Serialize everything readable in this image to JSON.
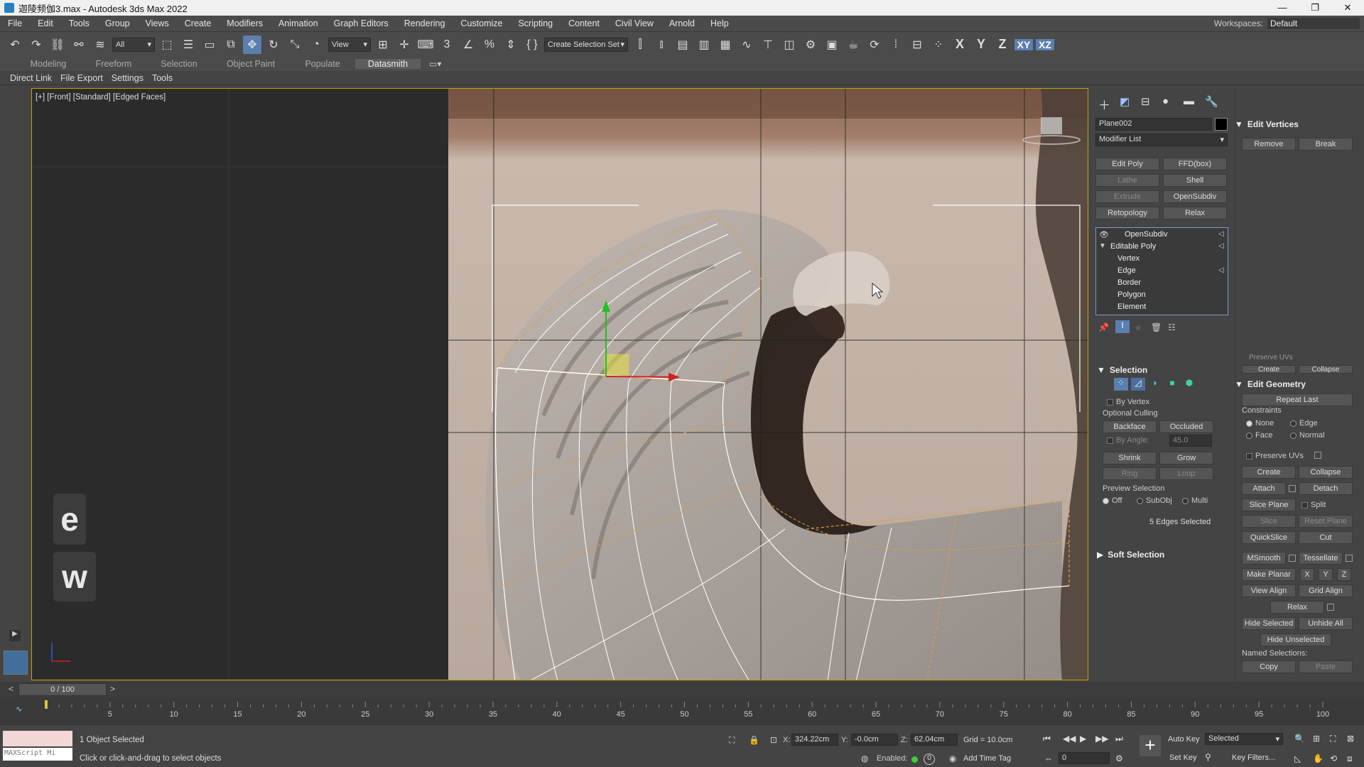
{
  "window": {
    "title": "迦陵频伽3.max - Autodesk 3ds Max 2022",
    "controls": [
      "—",
      "❐",
      "✕"
    ]
  },
  "menu": [
    "File",
    "Edit",
    "Tools",
    "Group",
    "Views",
    "Create",
    "Modifiers",
    "Animation",
    "Graph Editors",
    "Rendering",
    "Customize",
    "Scripting",
    "Content",
    "Civil View",
    "Arnold",
    "Help"
  ],
  "workspace": {
    "label": "Workspaces:",
    "value": "Default"
  },
  "toolbar": {
    "filter_value": "All",
    "refcoord_value": "View",
    "named_selection_value": "Create Selection Set",
    "axes": [
      "X",
      "Y",
      "Z",
      "XY",
      "XZ"
    ],
    "icons": [
      "undo-icon",
      "redo-icon",
      "link-icon",
      "unlink-icon",
      "bind-spacewarp-icon"
    ]
  },
  "ribbon_tabs": [
    "Modeling",
    "Freeform",
    "Selection",
    "Object Paint",
    "Populate",
    "Datasmith"
  ],
  "ribbon_active": "Datasmith",
  "subtoolbar": [
    "Direct Link",
    "File Export",
    "Settings",
    "Tools"
  ],
  "viewport": {
    "label": "[+] [Front] [Standard] [Edged Faces]",
    "key_overlays": [
      "e",
      "w"
    ],
    "colors": {
      "selection_border": "#c8a200",
      "wire": "#ffffff",
      "wire_orange": "#e0a040"
    }
  },
  "command_panel": {
    "object_name": "Plane002",
    "modifier_list": "Modifier List",
    "modifier_buttons": [
      {
        "label": "Edit Poly",
        "enabled": true
      },
      {
        "label": "FFD(box)",
        "enabled": true
      },
      {
        "label": "Lathe",
        "enabled": false
      },
      {
        "label": "Shell",
        "enabled": true
      },
      {
        "label": "Extrude",
        "enabled": false
      },
      {
        "label": "OpenSubdiv",
        "enabled": true
      },
      {
        "label": "Retopology",
        "enabled": true
      },
      {
        "label": "Relax",
        "enabled": true
      }
    ],
    "stack": {
      "top": "OpenSubdiv",
      "base": "Editable Poly",
      "subobjects": [
        "Vertex",
        "Edge",
        "Border",
        "Polygon",
        "Element"
      ],
      "active_subobject": "Edge"
    },
    "selection": {
      "title": "Selection",
      "by_vertex": "By Vertex",
      "optional_culling": "Optional Culling",
      "backface": "Backface",
      "occluded": "Occluded",
      "by_angle": "By Angle:",
      "angle_value": "45.0",
      "shrink": "Shrink",
      "grow": "Grow",
      "ring": "Ring",
      "loop": "Loop",
      "preview_selection": "Preview Selection",
      "preview_options": [
        "Off",
        "SubObj",
        "Multi"
      ],
      "status": "5 Edges Selected"
    },
    "soft_selection": "Soft Selection",
    "edit_vertices": {
      "title": "Edit Vertices",
      "remove": "Remove",
      "break": "Break"
    },
    "edit_geometry": {
      "title": "Edit Geometry",
      "partial_labels": [
        "Preserve UVs",
        "Create",
        "Collapse"
      ],
      "repeat_last": "Repeat Last",
      "constraints": "Constraints",
      "constraint_options": [
        "None",
        "Edge",
        "Face",
        "Normal"
      ],
      "preserve_uvs": "Preserve UVs",
      "create": "Create",
      "collapse": "Collapse",
      "attach": "Attach",
      "detach": "Detach",
      "slice_plane": "Slice Plane",
      "split": "Split",
      "slice": "Slice",
      "reset_plane": "Reset Plane",
      "quickslice": "QuickSlice",
      "cut": "Cut",
      "msmooth": "MSmooth",
      "tessellate": "Tessellate",
      "make_planar": "Make Planar",
      "planar_axes": [
        "X",
        "Y",
        "Z"
      ],
      "view_align": "View Align",
      "grid_align": "Grid Align",
      "relax": "Relax",
      "hide_selected": "Hide Selected",
      "unhide_all": "Unhide All",
      "hide_unselected": "Hide Unselected",
      "named_selections": "Named Selections:",
      "copy": "Copy",
      "paste": "Paste"
    }
  },
  "timeline": {
    "frame_display": "0 / 100",
    "ticks": [
      "5",
      "10",
      "15",
      "20",
      "25",
      "30",
      "35",
      "40",
      "45",
      "50",
      "55",
      "60",
      "65",
      "70",
      "75",
      "80",
      "85",
      "90",
      "95",
      "100"
    ],
    "current": 0,
    "total": 100
  },
  "status": {
    "maxscript": "MAXScript Mi",
    "selected": "1 Object Selected",
    "prompt": "Click or click-and-drag to select objects",
    "x_label": "X:",
    "x_value": "324.22cm",
    "y_label": "Y:",
    "y_value": "-0.0cm",
    "z_label": "Z:",
    "z_value": "62.04cm",
    "grid": "Grid = 10.0cm",
    "enabled": "Enabled:",
    "enabled_value": "0",
    "add_time_tag": "Add Time Tag",
    "auto_key": "Auto Key",
    "auto_key_mode": "Selected",
    "set_key": "Set Key",
    "key_filters": "Key Filters...",
    "frame_value": "0"
  }
}
